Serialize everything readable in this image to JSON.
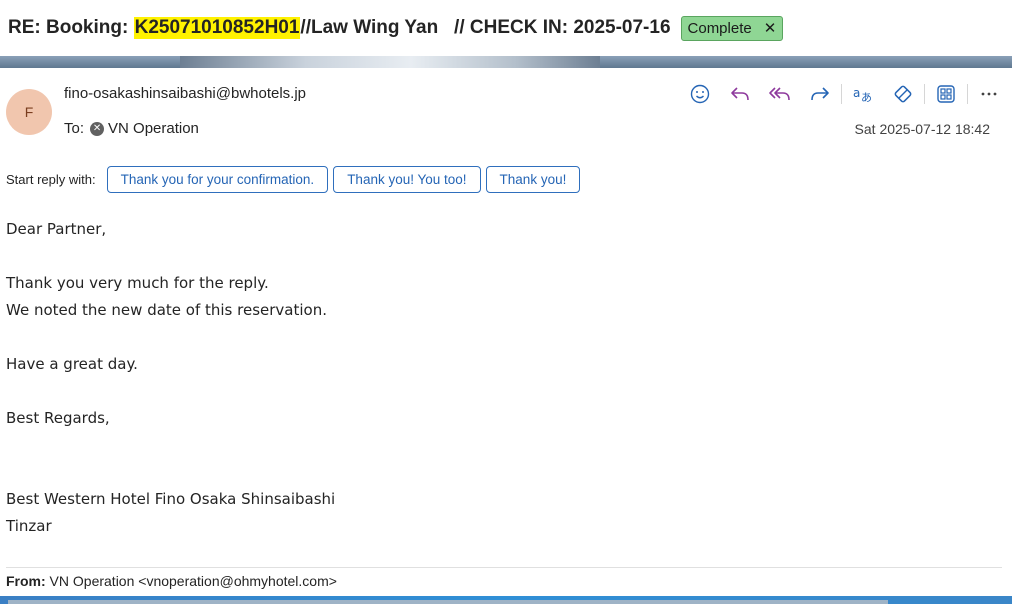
{
  "subject": {
    "prefix": "RE: Booking: ",
    "highlight": "K25071010852H01",
    "suffix": "//Law Wing Yan   // CHECK IN: 2025-07-16",
    "tag_label": "Complete",
    "tag_close": "✕"
  },
  "message": {
    "avatar_initial": "F",
    "sender": "fino-osakashinsaibashi@bwhotels.jp",
    "to_label": "To:",
    "recipient": "VN Operation",
    "date": "Sat 2025-07-12 18:42"
  },
  "toolbar": {
    "items": [
      "emoji-icon",
      "reply-icon",
      "reply-all-icon",
      "forward-icon",
      "translate-icon",
      "immersive-reader-icon",
      "apps-icon",
      "more-icon"
    ],
    "more_label": "···"
  },
  "quick_reply": {
    "label": "Start reply with:",
    "options": [
      "Thank you for your confirmation.",
      "Thank you! You too!",
      "Thank you!"
    ]
  },
  "body": {
    "line1": "Dear Partner,",
    "line2": "",
    "line3": "Thank you very much for the reply.",
    "line4": "We noted the new date of this reservation.",
    "line5": "",
    "line6": "Have a great day.",
    "line7": "",
    "line8": "Best Regards,",
    "line9": "",
    "line10": "",
    "line11": "Best Western Hotel Fino Osaka Shinsaibashi",
    "line12": "Tinzar"
  },
  "quoted": {
    "from_label": "From:",
    "from_value": " VN Operation <vnoperation@ohmyhotel.com>"
  },
  "colors": {
    "highlight": "#fff200",
    "tag_bg": "#8fd694",
    "accent": "#2565b5",
    "icon_purple": "#8e3a9d",
    "icon_blue": "#2565b5",
    "avatar_bg": "#f1c6ae"
  }
}
